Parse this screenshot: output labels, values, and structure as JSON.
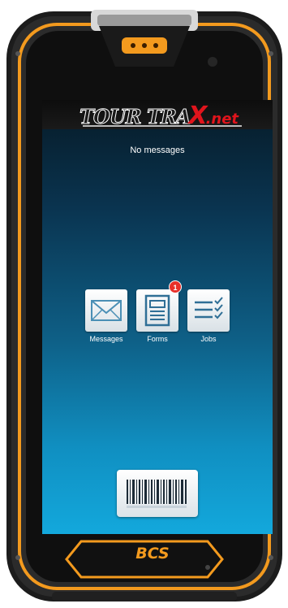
{
  "device": {
    "brand_label": "BCS",
    "frame_color": "#2a2a2a",
    "accent_color": "#f39a1e"
  },
  "app": {
    "logo": {
      "tour": "TOUR TRA",
      "x": "X",
      "net": ".net"
    },
    "status_text": "No messages"
  },
  "tiles": [
    {
      "label": "Messages",
      "icon": "envelope-icon"
    },
    {
      "label": "Forms",
      "icon": "form-document-icon",
      "badge": "1"
    },
    {
      "label": "Jobs",
      "icon": "checklist-icon"
    }
  ],
  "scan_button": {
    "icon": "barcode-icon"
  },
  "colors": {
    "badge": "#e8302a",
    "logo_red": "#e0141c",
    "screen_top": "#061a26",
    "screen_bottom": "#13a8dc"
  }
}
